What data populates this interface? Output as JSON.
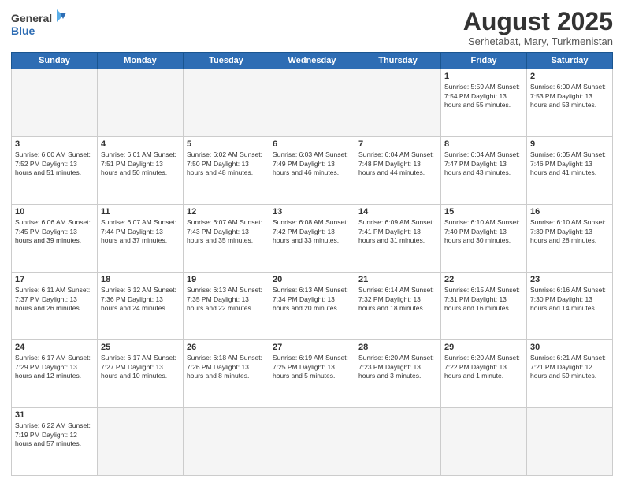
{
  "logo": {
    "line1": "General",
    "line2": "Blue"
  },
  "header": {
    "month_year": "August 2025",
    "location": "Serhetabat, Mary, Turkmenistan"
  },
  "weekdays": [
    "Sunday",
    "Monday",
    "Tuesday",
    "Wednesday",
    "Thursday",
    "Friday",
    "Saturday"
  ],
  "weeks": [
    [
      {
        "day": "",
        "info": ""
      },
      {
        "day": "",
        "info": ""
      },
      {
        "day": "",
        "info": ""
      },
      {
        "day": "",
        "info": ""
      },
      {
        "day": "",
        "info": ""
      },
      {
        "day": "1",
        "info": "Sunrise: 5:59 AM\nSunset: 7:54 PM\nDaylight: 13 hours\nand 55 minutes."
      },
      {
        "day": "2",
        "info": "Sunrise: 6:00 AM\nSunset: 7:53 PM\nDaylight: 13 hours\nand 53 minutes."
      }
    ],
    [
      {
        "day": "3",
        "info": "Sunrise: 6:00 AM\nSunset: 7:52 PM\nDaylight: 13 hours\nand 51 minutes."
      },
      {
        "day": "4",
        "info": "Sunrise: 6:01 AM\nSunset: 7:51 PM\nDaylight: 13 hours\nand 50 minutes."
      },
      {
        "day": "5",
        "info": "Sunrise: 6:02 AM\nSunset: 7:50 PM\nDaylight: 13 hours\nand 48 minutes."
      },
      {
        "day": "6",
        "info": "Sunrise: 6:03 AM\nSunset: 7:49 PM\nDaylight: 13 hours\nand 46 minutes."
      },
      {
        "day": "7",
        "info": "Sunrise: 6:04 AM\nSunset: 7:48 PM\nDaylight: 13 hours\nand 44 minutes."
      },
      {
        "day": "8",
        "info": "Sunrise: 6:04 AM\nSunset: 7:47 PM\nDaylight: 13 hours\nand 43 minutes."
      },
      {
        "day": "9",
        "info": "Sunrise: 6:05 AM\nSunset: 7:46 PM\nDaylight: 13 hours\nand 41 minutes."
      }
    ],
    [
      {
        "day": "10",
        "info": "Sunrise: 6:06 AM\nSunset: 7:45 PM\nDaylight: 13 hours\nand 39 minutes."
      },
      {
        "day": "11",
        "info": "Sunrise: 6:07 AM\nSunset: 7:44 PM\nDaylight: 13 hours\nand 37 minutes."
      },
      {
        "day": "12",
        "info": "Sunrise: 6:07 AM\nSunset: 7:43 PM\nDaylight: 13 hours\nand 35 minutes."
      },
      {
        "day": "13",
        "info": "Sunrise: 6:08 AM\nSunset: 7:42 PM\nDaylight: 13 hours\nand 33 minutes."
      },
      {
        "day": "14",
        "info": "Sunrise: 6:09 AM\nSunset: 7:41 PM\nDaylight: 13 hours\nand 31 minutes."
      },
      {
        "day": "15",
        "info": "Sunrise: 6:10 AM\nSunset: 7:40 PM\nDaylight: 13 hours\nand 30 minutes."
      },
      {
        "day": "16",
        "info": "Sunrise: 6:10 AM\nSunset: 7:39 PM\nDaylight: 13 hours\nand 28 minutes."
      }
    ],
    [
      {
        "day": "17",
        "info": "Sunrise: 6:11 AM\nSunset: 7:37 PM\nDaylight: 13 hours\nand 26 minutes."
      },
      {
        "day": "18",
        "info": "Sunrise: 6:12 AM\nSunset: 7:36 PM\nDaylight: 13 hours\nand 24 minutes."
      },
      {
        "day": "19",
        "info": "Sunrise: 6:13 AM\nSunset: 7:35 PM\nDaylight: 13 hours\nand 22 minutes."
      },
      {
        "day": "20",
        "info": "Sunrise: 6:13 AM\nSunset: 7:34 PM\nDaylight: 13 hours\nand 20 minutes."
      },
      {
        "day": "21",
        "info": "Sunrise: 6:14 AM\nSunset: 7:32 PM\nDaylight: 13 hours\nand 18 minutes."
      },
      {
        "day": "22",
        "info": "Sunrise: 6:15 AM\nSunset: 7:31 PM\nDaylight: 13 hours\nand 16 minutes."
      },
      {
        "day": "23",
        "info": "Sunrise: 6:16 AM\nSunset: 7:30 PM\nDaylight: 13 hours\nand 14 minutes."
      }
    ],
    [
      {
        "day": "24",
        "info": "Sunrise: 6:17 AM\nSunset: 7:29 PM\nDaylight: 13 hours\nand 12 minutes."
      },
      {
        "day": "25",
        "info": "Sunrise: 6:17 AM\nSunset: 7:27 PM\nDaylight: 13 hours\nand 10 minutes."
      },
      {
        "day": "26",
        "info": "Sunrise: 6:18 AM\nSunset: 7:26 PM\nDaylight: 13 hours\nand 8 minutes."
      },
      {
        "day": "27",
        "info": "Sunrise: 6:19 AM\nSunset: 7:25 PM\nDaylight: 13 hours\nand 5 minutes."
      },
      {
        "day": "28",
        "info": "Sunrise: 6:20 AM\nSunset: 7:23 PM\nDaylight: 13 hours\nand 3 minutes."
      },
      {
        "day": "29",
        "info": "Sunrise: 6:20 AM\nSunset: 7:22 PM\nDaylight: 13 hours\nand 1 minute."
      },
      {
        "day": "30",
        "info": "Sunrise: 6:21 AM\nSunset: 7:21 PM\nDaylight: 12 hours\nand 59 minutes."
      }
    ],
    [
      {
        "day": "31",
        "info": "Sunrise: 6:22 AM\nSunset: 7:19 PM\nDaylight: 12 hours\nand 57 minutes."
      },
      {
        "day": "",
        "info": ""
      },
      {
        "day": "",
        "info": ""
      },
      {
        "day": "",
        "info": ""
      },
      {
        "day": "",
        "info": ""
      },
      {
        "day": "",
        "info": ""
      },
      {
        "day": "",
        "info": ""
      }
    ]
  ]
}
